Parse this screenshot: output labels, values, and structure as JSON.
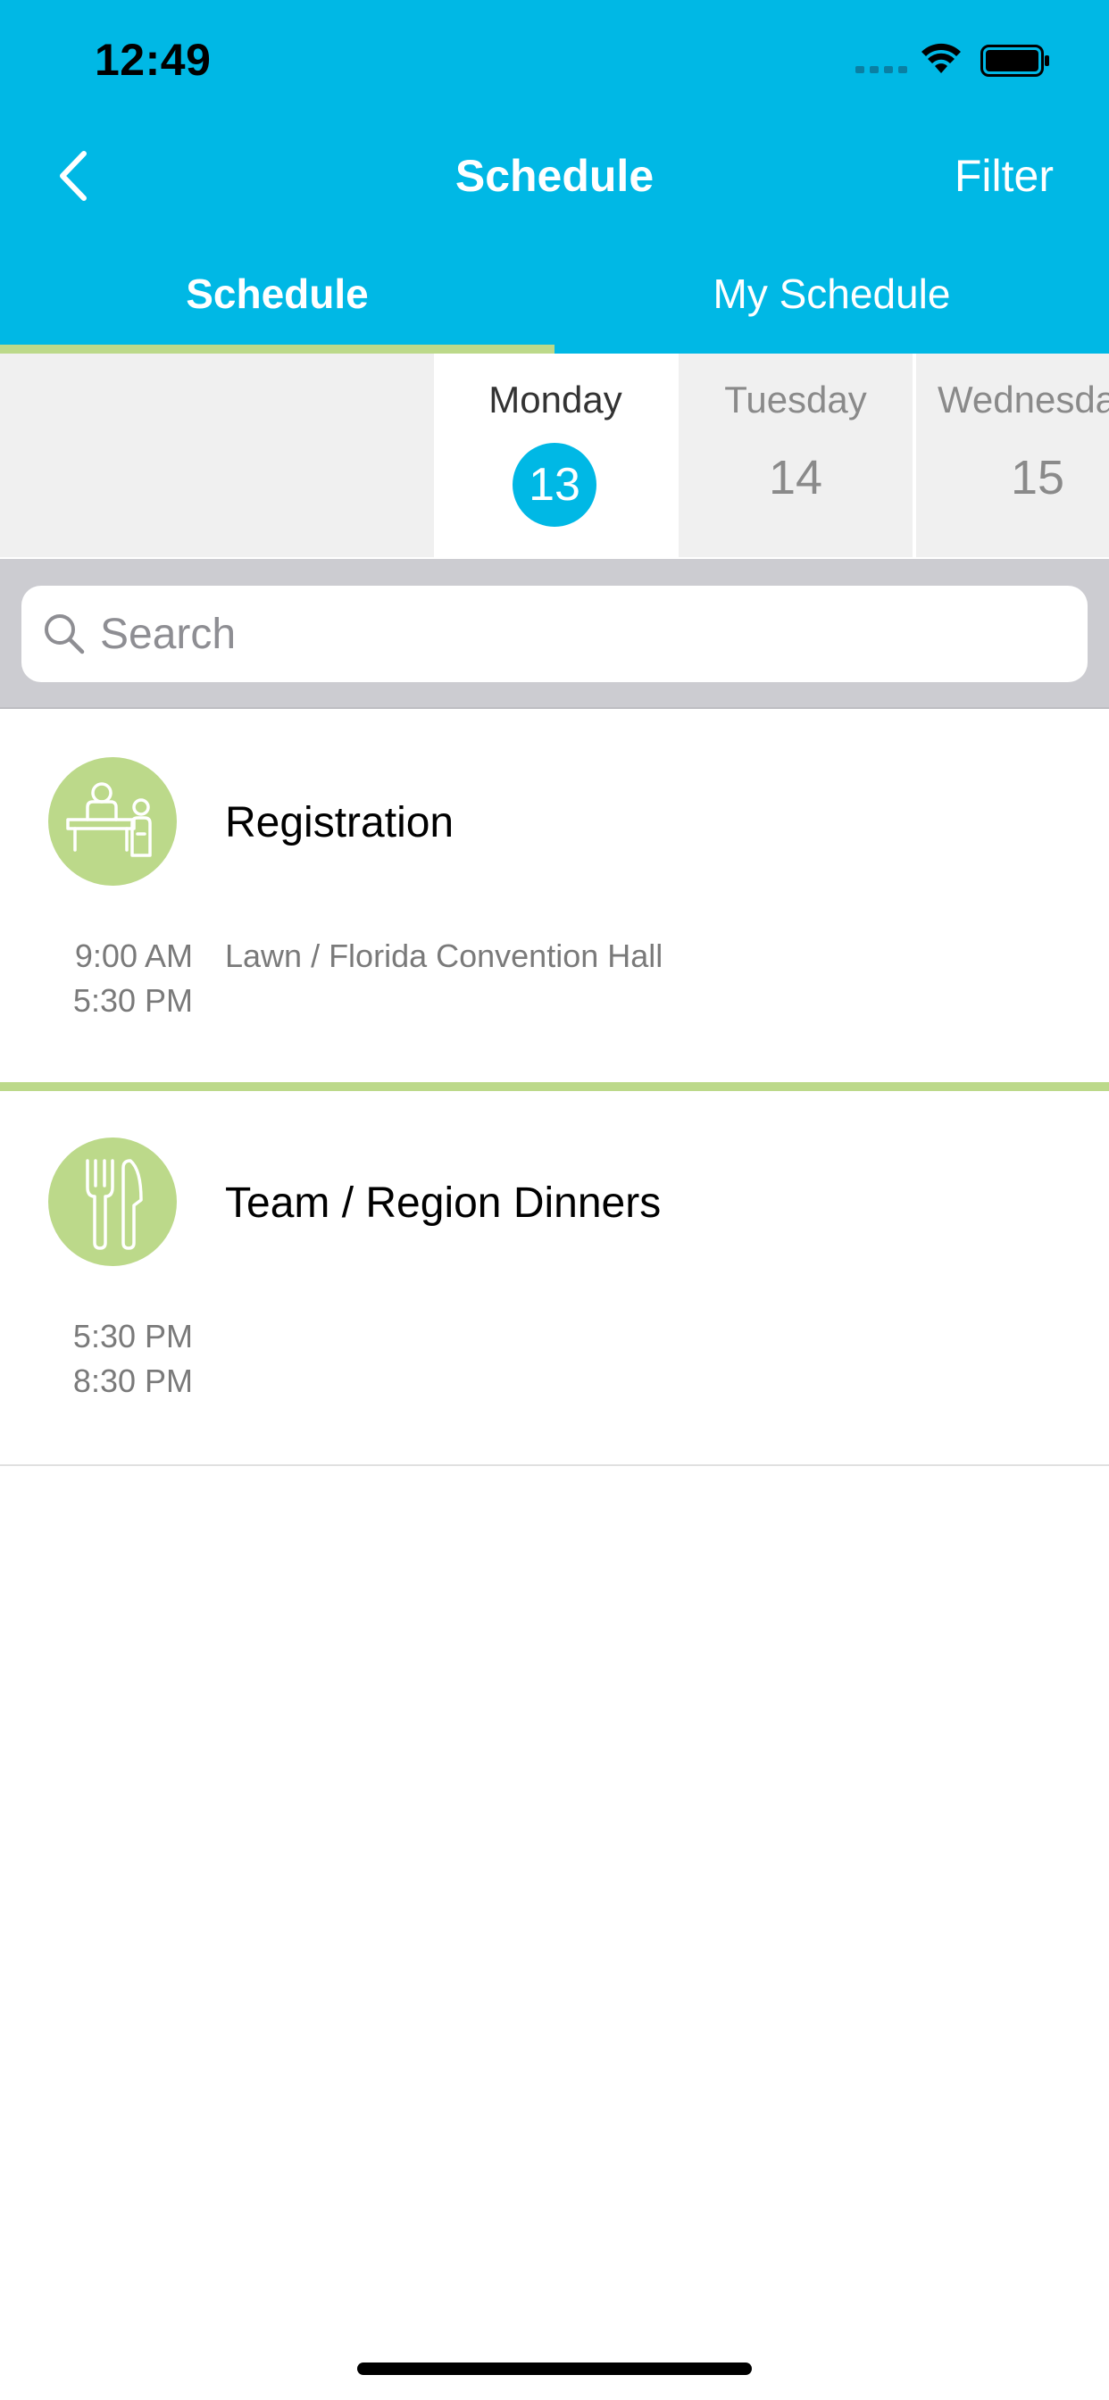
{
  "status_bar": {
    "time": "12:49"
  },
  "nav": {
    "title": "Schedule",
    "filter_label": "Filter"
  },
  "tabs": [
    {
      "label": "Schedule",
      "active": true
    },
    {
      "label": "My Schedule",
      "active": false
    }
  ],
  "days": [
    {
      "name": "Monday",
      "number": "13",
      "selected": true
    },
    {
      "name": "Tuesday",
      "number": "14",
      "selected": false
    },
    {
      "name": "Wednesday",
      "number": "15",
      "selected": false
    }
  ],
  "search": {
    "placeholder": "Search",
    "value": ""
  },
  "events": [
    {
      "title": "Registration",
      "icon": "registration-desk-icon",
      "start": "9:00 AM",
      "end": "5:30 PM",
      "location": "Lawn / Florida Convention Hall"
    },
    {
      "title": "Team / Region Dinners",
      "icon": "fork-knife-icon",
      "start": "5:30 PM",
      "end": "8:30 PM",
      "location": ""
    }
  ],
  "colors": {
    "header": "#00B8E5",
    "accent_green": "#BCD98A",
    "day_bg": "#F0F0F0",
    "search_bg": "#CCCCD1"
  }
}
